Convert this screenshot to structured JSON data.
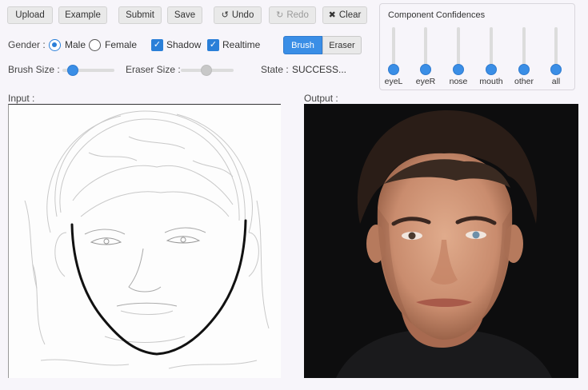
{
  "toolbar": {
    "upload": "Upload",
    "example": "Example",
    "submit": "Submit",
    "save": "Save",
    "undo": "Undo",
    "redo": "Redo",
    "clear": "Clear"
  },
  "gender": {
    "label": "Gender :",
    "options": [
      "Male",
      "Female"
    ],
    "selected": "Male"
  },
  "toggles": {
    "shadow": {
      "label": "Shadow",
      "checked": true
    },
    "realtime": {
      "label": "Realtime",
      "checked": true
    }
  },
  "mode": {
    "brush": "Brush",
    "eraser": "Eraser",
    "selected": "Brush"
  },
  "sliders": {
    "brush_size": {
      "label": "Brush Size :",
      "value": 0.2
    },
    "eraser_size": {
      "label": "Eraser Size :",
      "value": 0.5
    }
  },
  "state": {
    "label": "State :",
    "value": "SUCCESS..."
  },
  "confidences": {
    "title": "Component Confidences",
    "items": [
      {
        "label": "eyeL",
        "value": 0
      },
      {
        "label": "eyeR",
        "value": 0
      },
      {
        "label": "nose",
        "value": 0
      },
      {
        "label": "mouth",
        "value": 0
      },
      {
        "label": "other",
        "value": 0
      },
      {
        "label": "all",
        "value": 0
      }
    ]
  },
  "input": {
    "label": "Input :"
  },
  "output": {
    "label": "Output :"
  },
  "icons": {
    "undo": "undo-icon",
    "redo": "redo-icon",
    "clear": "close-icon"
  },
  "colors": {
    "accent": "#3a8ee6",
    "background": "#f7f5fa"
  }
}
